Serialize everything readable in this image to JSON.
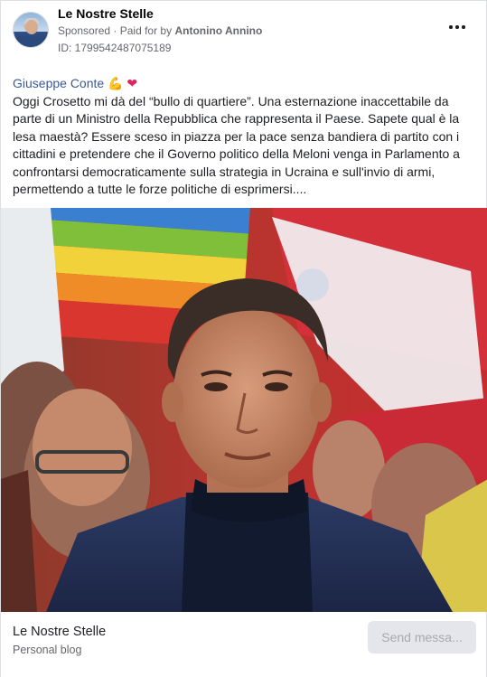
{
  "header": {
    "page_name": "Le Nostre Stelle",
    "sponsored": "Sponsored",
    "separator": "·",
    "paid_for_prefix": "Paid for by",
    "paid_for_by": "Antonino Annino",
    "ad_id": "ID: 1799542487075189"
  },
  "post": {
    "author": "Giuseppe Conte",
    "author_emoji": "💪",
    "author_heart": "❤",
    "body": "Oggi Crosetto mi dà del “bullo di quartiere”. Una esternazione inaccettabile da parte di un Ministro della Repubblica che rappresenta il Paese. Sapete qual è la lesa maestà? Essere sceso in piazza per la pace senza bandiera di partito con i cittadini e pretendere che il Governo politico della Meloni venga in Parlamento a confrontarsi democraticamente sulla strategia in Ucraina e sull'invio di armi, permettendo a tutte le forze politiche di esprimersi...."
  },
  "footer": {
    "page_name": "Le Nostre Stelle",
    "category": "Personal blog",
    "send_button": "Send messa..."
  },
  "icons": {
    "more": "more-options-icon"
  }
}
